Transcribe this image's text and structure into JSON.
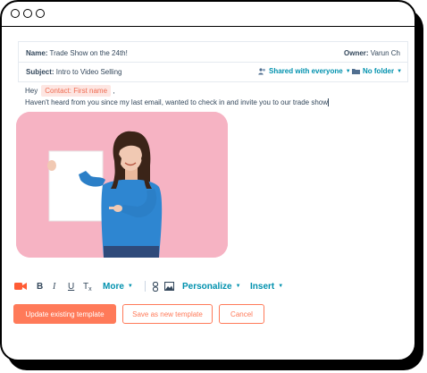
{
  "email": {
    "name_label": "Name:",
    "name_value": "Trade Show on the 24th!",
    "owner_label": "Owner:",
    "owner_value": "Varun Ch",
    "subject_label": "Subject:",
    "subject_value": "Intro to Video Selling",
    "shared_label": "Shared with everyone",
    "folder_label": "No folder",
    "greeting": "Hey",
    "token_label": "Contact: First name",
    "token_suffix": ",",
    "body_line": "Haven't heard from you since my last email, wanted to check in and invite you to our trade show"
  },
  "toolbar": {
    "bold": "B",
    "italic": "I",
    "underline": "U",
    "clear_format": "T",
    "more_label": "More",
    "personalize_label": "Personalize",
    "insert_label": "Insert"
  },
  "actions": {
    "update_label": "Update existing template",
    "save_new_label": "Save as new template",
    "cancel_label": "Cancel"
  },
  "icons": {
    "video": "video-camera-icon",
    "users": "users-icon",
    "folder": "folder-icon",
    "link": "link-icon",
    "image": "image-icon"
  },
  "colors": {
    "accent": "#ff7a59",
    "link": "#0091ae",
    "token_bg": "#fde6e2",
    "photo_bg": "#f7b8c8"
  }
}
